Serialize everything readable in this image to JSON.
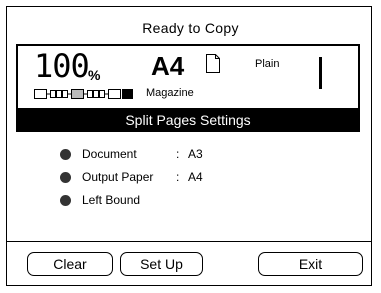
{
  "screen": {
    "title": "Ready to Copy"
  },
  "status": {
    "zoom_value": "100",
    "zoom_unit": "%",
    "paper_size": "A4",
    "paper_type": "Plain",
    "paper_source": "Magazine",
    "copy_count": 1,
    "paper_level_icon": "paper-level-meter",
    "document_icon": "document-page-icon"
  },
  "section": {
    "title": "Split Pages Settings"
  },
  "settings": [
    {
      "label": "Document",
      "separator": ":",
      "value": "A3"
    },
    {
      "label": "Output Paper",
      "separator": ":",
      "value": "A4"
    },
    {
      "label": "Left Bound",
      "separator": "",
      "value": ""
    }
  ],
  "buttons": {
    "clear": "Clear",
    "setup": "Set Up",
    "exit": "Exit"
  }
}
